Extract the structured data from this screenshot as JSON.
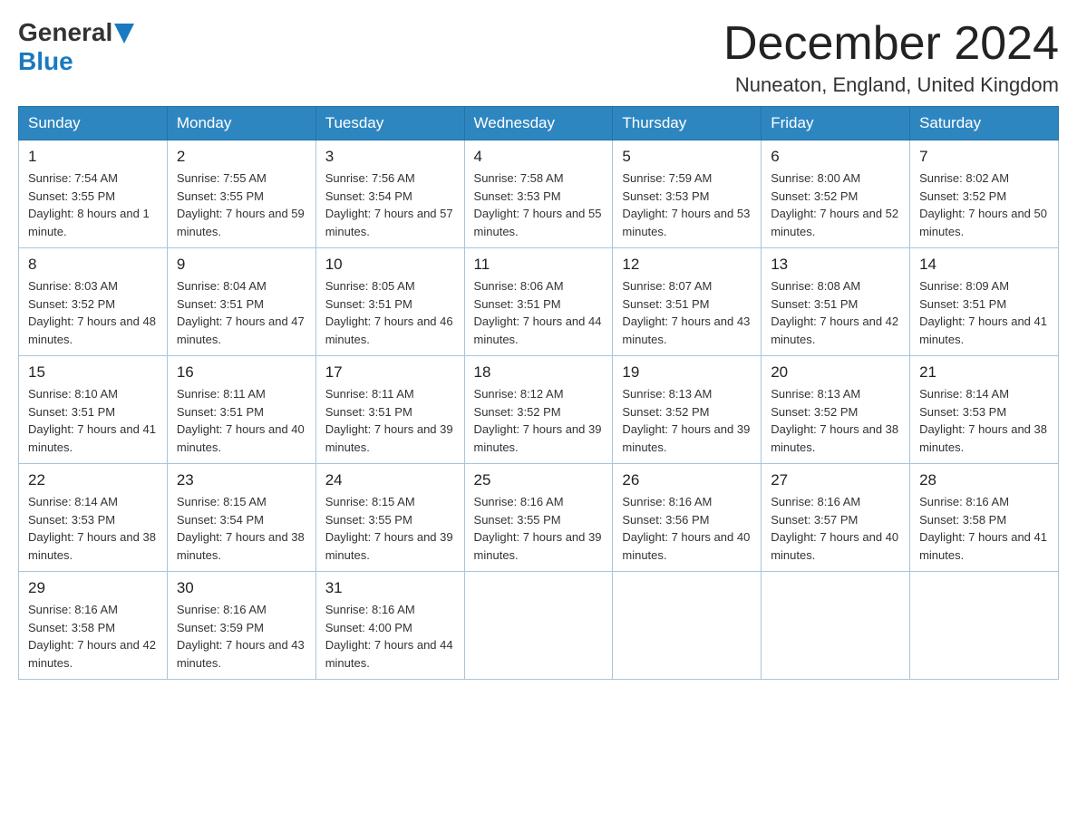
{
  "logo": {
    "general": "General",
    "blue": "Blue"
  },
  "title": {
    "month": "December 2024",
    "location": "Nuneaton, England, United Kingdom"
  },
  "days_of_week": [
    "Sunday",
    "Monday",
    "Tuesday",
    "Wednesday",
    "Thursday",
    "Friday",
    "Saturday"
  ],
  "weeks": [
    [
      {
        "day": "1",
        "sunrise": "Sunrise: 7:54 AM",
        "sunset": "Sunset: 3:55 PM",
        "daylight": "Daylight: 8 hours and 1 minute."
      },
      {
        "day": "2",
        "sunrise": "Sunrise: 7:55 AM",
        "sunset": "Sunset: 3:55 PM",
        "daylight": "Daylight: 7 hours and 59 minutes."
      },
      {
        "day": "3",
        "sunrise": "Sunrise: 7:56 AM",
        "sunset": "Sunset: 3:54 PM",
        "daylight": "Daylight: 7 hours and 57 minutes."
      },
      {
        "day": "4",
        "sunrise": "Sunrise: 7:58 AM",
        "sunset": "Sunset: 3:53 PM",
        "daylight": "Daylight: 7 hours and 55 minutes."
      },
      {
        "day": "5",
        "sunrise": "Sunrise: 7:59 AM",
        "sunset": "Sunset: 3:53 PM",
        "daylight": "Daylight: 7 hours and 53 minutes."
      },
      {
        "day": "6",
        "sunrise": "Sunrise: 8:00 AM",
        "sunset": "Sunset: 3:52 PM",
        "daylight": "Daylight: 7 hours and 52 minutes."
      },
      {
        "day": "7",
        "sunrise": "Sunrise: 8:02 AM",
        "sunset": "Sunset: 3:52 PM",
        "daylight": "Daylight: 7 hours and 50 minutes."
      }
    ],
    [
      {
        "day": "8",
        "sunrise": "Sunrise: 8:03 AM",
        "sunset": "Sunset: 3:52 PM",
        "daylight": "Daylight: 7 hours and 48 minutes."
      },
      {
        "day": "9",
        "sunrise": "Sunrise: 8:04 AM",
        "sunset": "Sunset: 3:51 PM",
        "daylight": "Daylight: 7 hours and 47 minutes."
      },
      {
        "day": "10",
        "sunrise": "Sunrise: 8:05 AM",
        "sunset": "Sunset: 3:51 PM",
        "daylight": "Daylight: 7 hours and 46 minutes."
      },
      {
        "day": "11",
        "sunrise": "Sunrise: 8:06 AM",
        "sunset": "Sunset: 3:51 PM",
        "daylight": "Daylight: 7 hours and 44 minutes."
      },
      {
        "day": "12",
        "sunrise": "Sunrise: 8:07 AM",
        "sunset": "Sunset: 3:51 PM",
        "daylight": "Daylight: 7 hours and 43 minutes."
      },
      {
        "day": "13",
        "sunrise": "Sunrise: 8:08 AM",
        "sunset": "Sunset: 3:51 PM",
        "daylight": "Daylight: 7 hours and 42 minutes."
      },
      {
        "day": "14",
        "sunrise": "Sunrise: 8:09 AM",
        "sunset": "Sunset: 3:51 PM",
        "daylight": "Daylight: 7 hours and 41 minutes."
      }
    ],
    [
      {
        "day": "15",
        "sunrise": "Sunrise: 8:10 AM",
        "sunset": "Sunset: 3:51 PM",
        "daylight": "Daylight: 7 hours and 41 minutes."
      },
      {
        "day": "16",
        "sunrise": "Sunrise: 8:11 AM",
        "sunset": "Sunset: 3:51 PM",
        "daylight": "Daylight: 7 hours and 40 minutes."
      },
      {
        "day": "17",
        "sunrise": "Sunrise: 8:11 AM",
        "sunset": "Sunset: 3:51 PM",
        "daylight": "Daylight: 7 hours and 39 minutes."
      },
      {
        "day": "18",
        "sunrise": "Sunrise: 8:12 AM",
        "sunset": "Sunset: 3:52 PM",
        "daylight": "Daylight: 7 hours and 39 minutes."
      },
      {
        "day": "19",
        "sunrise": "Sunrise: 8:13 AM",
        "sunset": "Sunset: 3:52 PM",
        "daylight": "Daylight: 7 hours and 39 minutes."
      },
      {
        "day": "20",
        "sunrise": "Sunrise: 8:13 AM",
        "sunset": "Sunset: 3:52 PM",
        "daylight": "Daylight: 7 hours and 38 minutes."
      },
      {
        "day": "21",
        "sunrise": "Sunrise: 8:14 AM",
        "sunset": "Sunset: 3:53 PM",
        "daylight": "Daylight: 7 hours and 38 minutes."
      }
    ],
    [
      {
        "day": "22",
        "sunrise": "Sunrise: 8:14 AM",
        "sunset": "Sunset: 3:53 PM",
        "daylight": "Daylight: 7 hours and 38 minutes."
      },
      {
        "day": "23",
        "sunrise": "Sunrise: 8:15 AM",
        "sunset": "Sunset: 3:54 PM",
        "daylight": "Daylight: 7 hours and 38 minutes."
      },
      {
        "day": "24",
        "sunrise": "Sunrise: 8:15 AM",
        "sunset": "Sunset: 3:55 PM",
        "daylight": "Daylight: 7 hours and 39 minutes."
      },
      {
        "day": "25",
        "sunrise": "Sunrise: 8:16 AM",
        "sunset": "Sunset: 3:55 PM",
        "daylight": "Daylight: 7 hours and 39 minutes."
      },
      {
        "day": "26",
        "sunrise": "Sunrise: 8:16 AM",
        "sunset": "Sunset: 3:56 PM",
        "daylight": "Daylight: 7 hours and 40 minutes."
      },
      {
        "day": "27",
        "sunrise": "Sunrise: 8:16 AM",
        "sunset": "Sunset: 3:57 PM",
        "daylight": "Daylight: 7 hours and 40 minutes."
      },
      {
        "day": "28",
        "sunrise": "Sunrise: 8:16 AM",
        "sunset": "Sunset: 3:58 PM",
        "daylight": "Daylight: 7 hours and 41 minutes."
      }
    ],
    [
      {
        "day": "29",
        "sunrise": "Sunrise: 8:16 AM",
        "sunset": "Sunset: 3:58 PM",
        "daylight": "Daylight: 7 hours and 42 minutes."
      },
      {
        "day": "30",
        "sunrise": "Sunrise: 8:16 AM",
        "sunset": "Sunset: 3:59 PM",
        "daylight": "Daylight: 7 hours and 43 minutes."
      },
      {
        "day": "31",
        "sunrise": "Sunrise: 8:16 AM",
        "sunset": "Sunset: 4:00 PM",
        "daylight": "Daylight: 7 hours and 44 minutes."
      },
      null,
      null,
      null,
      null
    ]
  ]
}
